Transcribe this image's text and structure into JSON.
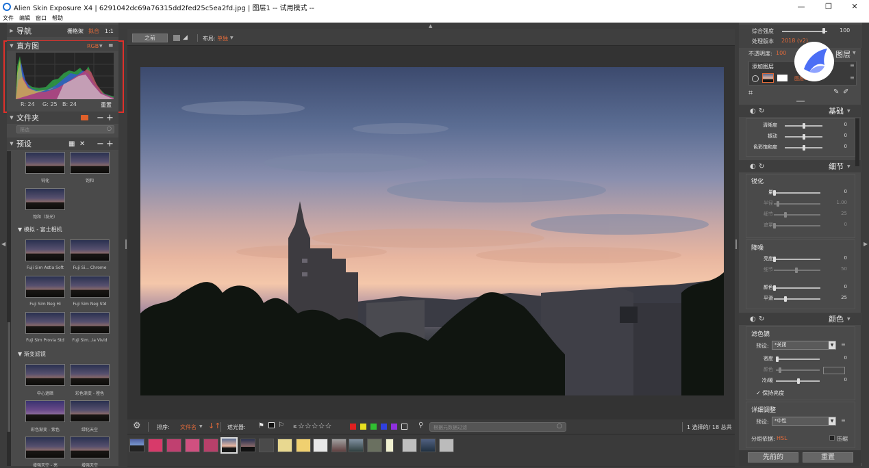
{
  "title": {
    "text": "Alien Skin Exposure X4 | 6291042dc69a76315dd2fed25c5ea2fd.jpg | 图层1 -- 试用模式 --",
    "minimize": "—",
    "maximize": "❐",
    "close": "✕"
  },
  "menu": [
    "文件",
    "编辑",
    "窗口",
    "帮助"
  ],
  "left": {
    "nav": {
      "label": "导航",
      "grid": "栅格架",
      "fit": "拟合",
      "one": "1:1"
    },
    "histogram": {
      "label": "直方图",
      "mode": "RGB",
      "r": "R: 24",
      "g": "G: 25",
      "b": "B: 24",
      "reset": "重置"
    },
    "folder": {
      "label": "文件夹",
      "search_placeholder": "筛选"
    },
    "presets": {
      "label": "预设",
      "top_thumbs": [
        {
          "label": "钝化"
        },
        {
          "label": "饱和"
        },
        {
          "label": "饱和（发光）"
        }
      ],
      "groups": [
        {
          "name": "模拟 - 富士相机",
          "items": [
            "Fuji Sim Astia Soft",
            "Fuji Si... Chrome",
            "Fuji Sim Neg Hi",
            "Fuji Sim Neg Std",
            "Fuji Sim Provia Std",
            "Fuji Sim...ia Vivid"
          ]
        },
        {
          "name": "渐变滤镜",
          "items": [
            "中心遮暗",
            "彩色渐变 - 橙色",
            "彩色渐变 - 紫色",
            "绿化天空",
            "增强天空 - 亮",
            "增强天空"
          ]
        }
      ]
    }
  },
  "center": {
    "before_button": "之前",
    "layout_label": "布局:",
    "layout_value": "单独",
    "toolbar": {
      "sort_label": "排序:",
      "sort_value": "文件名",
      "filter_label": "遮光器:",
      "flag_filter": "≥",
      "stars": "☆☆☆☆☆",
      "search_placeholder": "根据元数据过滤",
      "count": "1 选择的/ 18 总共"
    },
    "color_labels": [
      "#e02020",
      "#e8e020",
      "#30c030",
      "#3040e0",
      "#9030e0"
    ]
  },
  "right": {
    "top": {
      "opacity_label": "综合强度",
      "opacity_value": "100",
      "version_label": "处理版本",
      "version_value": "2018 (v2)",
      "layer_opacity_label": "不透明度:",
      "layer_opacity_value": "100",
      "layers_label": "图层",
      "add_layer": "添加图层",
      "layer_name": "图层1"
    },
    "basic": {
      "label": "基础",
      "sliders": [
        {
          "label": "清晰度",
          "value": "0"
        },
        {
          "label": "振动",
          "value": "0"
        },
        {
          "label": "色彩饱和度",
          "value": "0"
        }
      ]
    },
    "detail": {
      "label": "细节",
      "sharpen_label": "锐化",
      "sharpen": [
        {
          "label": "量",
          "value": "0"
        },
        {
          "label": "半径",
          "value": "1.00"
        },
        {
          "label": "细节",
          "value": "25"
        },
        {
          "label": "遮罩",
          "value": "0"
        }
      ],
      "noise_label": "降噪",
      "noise": [
        {
          "label": "亮度",
          "value": "0"
        },
        {
          "label": "细节",
          "value": "50"
        },
        {
          "label": "颜色",
          "value": "0"
        },
        {
          "label": "平滑",
          "value": "25"
        }
      ]
    },
    "color": {
      "label": "颜色",
      "filter_label": "滤色镜",
      "preset_label": "预设:",
      "preset_value": "*关闭",
      "density_label": "密度",
      "density_value": "0",
      "hue_label": "颜色",
      "warmth_label": "冷/暖",
      "warmth_value": "0",
      "preserve_label": "保持亮度",
      "preserve_check": "✓",
      "detail_label": "详细调整",
      "preset2_label": "预设:",
      "preset2_value": "*中性",
      "group_label": "分组依据:",
      "group_value": "HSL",
      "compress_label": "压缩"
    },
    "footer": {
      "prev": "先前的",
      "reset": "重置"
    }
  }
}
